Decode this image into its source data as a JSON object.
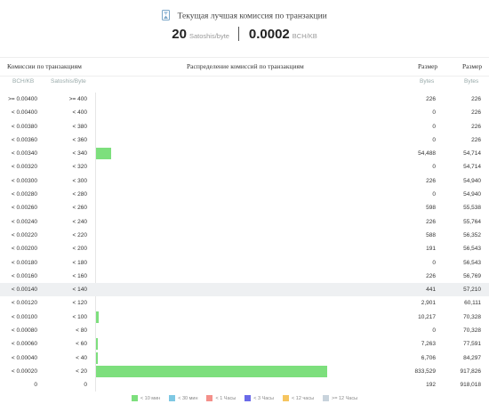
{
  "header": {
    "title": "Текущая лучшая комиссия по транзакции",
    "fee_sat": "20",
    "fee_sat_unit": "Satoshis/byte",
    "fee_bch": "0.0002",
    "fee_bch_unit": "BCH/KB",
    "icon": "hourglass-icon"
  },
  "table": {
    "col_fee_header": "Комиссии по транзакциям",
    "col_dist_header": "Распределение комиссий по транзакциям",
    "col_size1_header": "Размер",
    "col_size2_header": "Размер",
    "sub_bch": "BCH/KB",
    "sub_sat": "Satoshis/Byte",
    "sub_bytes1": "Bytes",
    "sub_bytes2": "Bytes",
    "rows": [
      {
        "bch": ">= 0.00400",
        "sat": ">= 400",
        "size": "226",
        "cum": "226",
        "bar": 0
      },
      {
        "bch": "< 0.00400",
        "sat": "< 400",
        "size": "0",
        "cum": "226",
        "bar": 0
      },
      {
        "bch": "< 0.00380",
        "sat": "< 380",
        "size": "0",
        "cum": "226",
        "bar": 0
      },
      {
        "bch": "< 0.00360",
        "sat": "< 360",
        "size": "0",
        "cum": "226",
        "bar": 0
      },
      {
        "bch": "< 0.00340",
        "sat": "< 340",
        "size": "54,488",
        "cum": "54,714",
        "bar": 54488
      },
      {
        "bch": "< 0.00320",
        "sat": "< 320",
        "size": "0",
        "cum": "54,714",
        "bar": 0
      },
      {
        "bch": "< 0.00300",
        "sat": "< 300",
        "size": "226",
        "cum": "54,940",
        "bar": 0
      },
      {
        "bch": "< 0.00280",
        "sat": "< 280",
        "size": "0",
        "cum": "54,940",
        "bar": 0
      },
      {
        "bch": "< 0.00260",
        "sat": "< 260",
        "size": "598",
        "cum": "55,538",
        "bar": 0
      },
      {
        "bch": "< 0.00240",
        "sat": "< 240",
        "size": "226",
        "cum": "55,764",
        "bar": 0
      },
      {
        "bch": "< 0.00220",
        "sat": "< 220",
        "size": "588",
        "cum": "56,352",
        "bar": 0
      },
      {
        "bch": "< 0.00200",
        "sat": "< 200",
        "size": "191",
        "cum": "56,543",
        "bar": 0
      },
      {
        "bch": "< 0.00180",
        "sat": "< 180",
        "size": "0",
        "cum": "56,543",
        "bar": 0
      },
      {
        "bch": "< 0.00160",
        "sat": "< 160",
        "size": "226",
        "cum": "56,769",
        "bar": 0
      },
      {
        "bch": "< 0.00140",
        "sat": "< 140",
        "size": "441",
        "cum": "57,210",
        "bar": 0,
        "highlight": true
      },
      {
        "bch": "< 0.00120",
        "sat": "< 120",
        "size": "2,901",
        "cum": "60,111",
        "bar": 0
      },
      {
        "bch": "< 0.00100",
        "sat": "< 100",
        "size": "10,217",
        "cum": "70,328",
        "bar": 10217
      },
      {
        "bch": "< 0.00080",
        "sat": "< 80",
        "size": "0",
        "cum": "70,328",
        "bar": 0
      },
      {
        "bch": "< 0.00060",
        "sat": "< 60",
        "size": "7,263",
        "cum": "77,591",
        "bar": 7263
      },
      {
        "bch": "< 0.00040",
        "sat": "< 40",
        "size": "6,706",
        "cum": "84,297",
        "bar": 6706
      },
      {
        "bch": "< 0.00020",
        "sat": "< 20",
        "size": "833,529",
        "cum": "917,826",
        "bar": 833529
      },
      {
        "bch": "0",
        "sat": "0",
        "size": "192",
        "cum": "918,018",
        "bar": 0
      }
    ]
  },
  "legend": [
    {
      "label": "< 10 мин",
      "color": "#7ddf7d"
    },
    {
      "label": "< 30 мин",
      "color": "#7ec8e3"
    },
    {
      "label": "< 1 Часы",
      "color": "#f4908a"
    },
    {
      "label": "< 3 Часы",
      "color": "#6a6ae8"
    },
    {
      "label": "< 12 часы",
      "color": "#f6c560"
    },
    {
      "label": ">= 12 Часы",
      "color": "#c8d3dc"
    }
  ]
}
